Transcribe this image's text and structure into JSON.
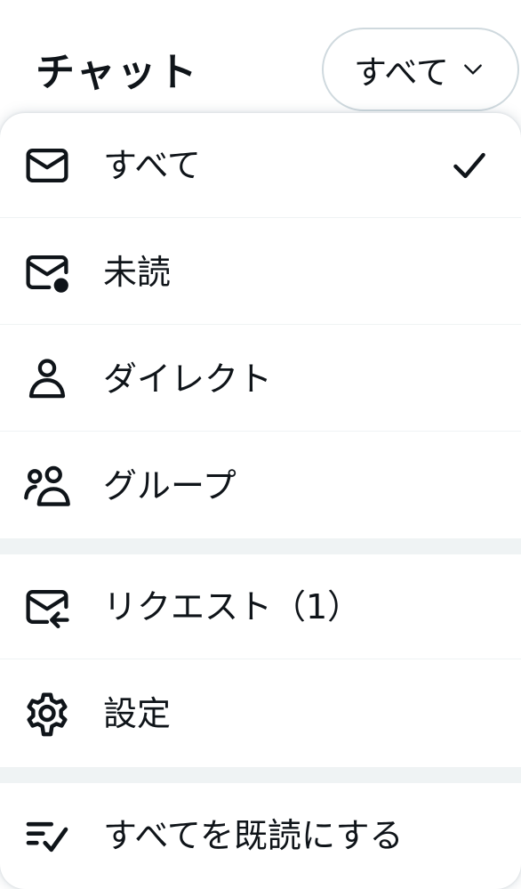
{
  "header": {
    "title": "チャット",
    "filter_label": "すべて"
  },
  "menu": {
    "items": [
      {
        "label": "すべて",
        "icon": "mail-icon",
        "selected": true
      },
      {
        "label": "未読",
        "icon": "mail-unread-icon",
        "selected": false
      },
      {
        "label": "ダイレクト",
        "icon": "person-icon",
        "selected": false
      },
      {
        "label": "グループ",
        "icon": "people-icon",
        "selected": false
      },
      {
        "label": "リクエスト（1）",
        "icon": "mail-request-icon",
        "selected": false
      },
      {
        "label": "設定",
        "icon": "gear-icon",
        "selected": false
      },
      {
        "label": "すべてを既読にする",
        "icon": "mark-read-icon",
        "selected": false
      }
    ]
  }
}
